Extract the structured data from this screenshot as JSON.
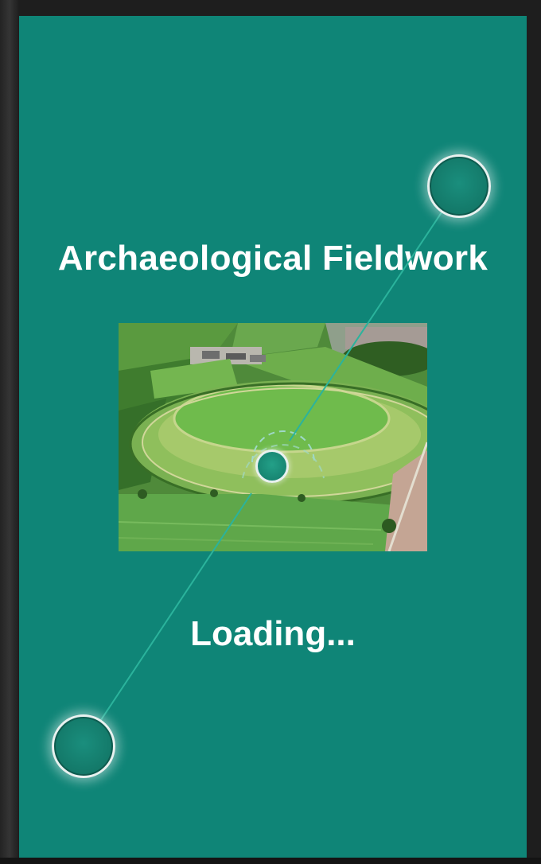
{
  "app": {
    "title": "Archaeological Fieldwork",
    "status": "Loading..."
  },
  "colors": {
    "screen_background": "#0f8577",
    "text": "#ffffff",
    "handle_ring": "#e9f1ef",
    "connector_line": "#2bb39c"
  },
  "image": {
    "subject": "aerial-hillfort-photo"
  }
}
